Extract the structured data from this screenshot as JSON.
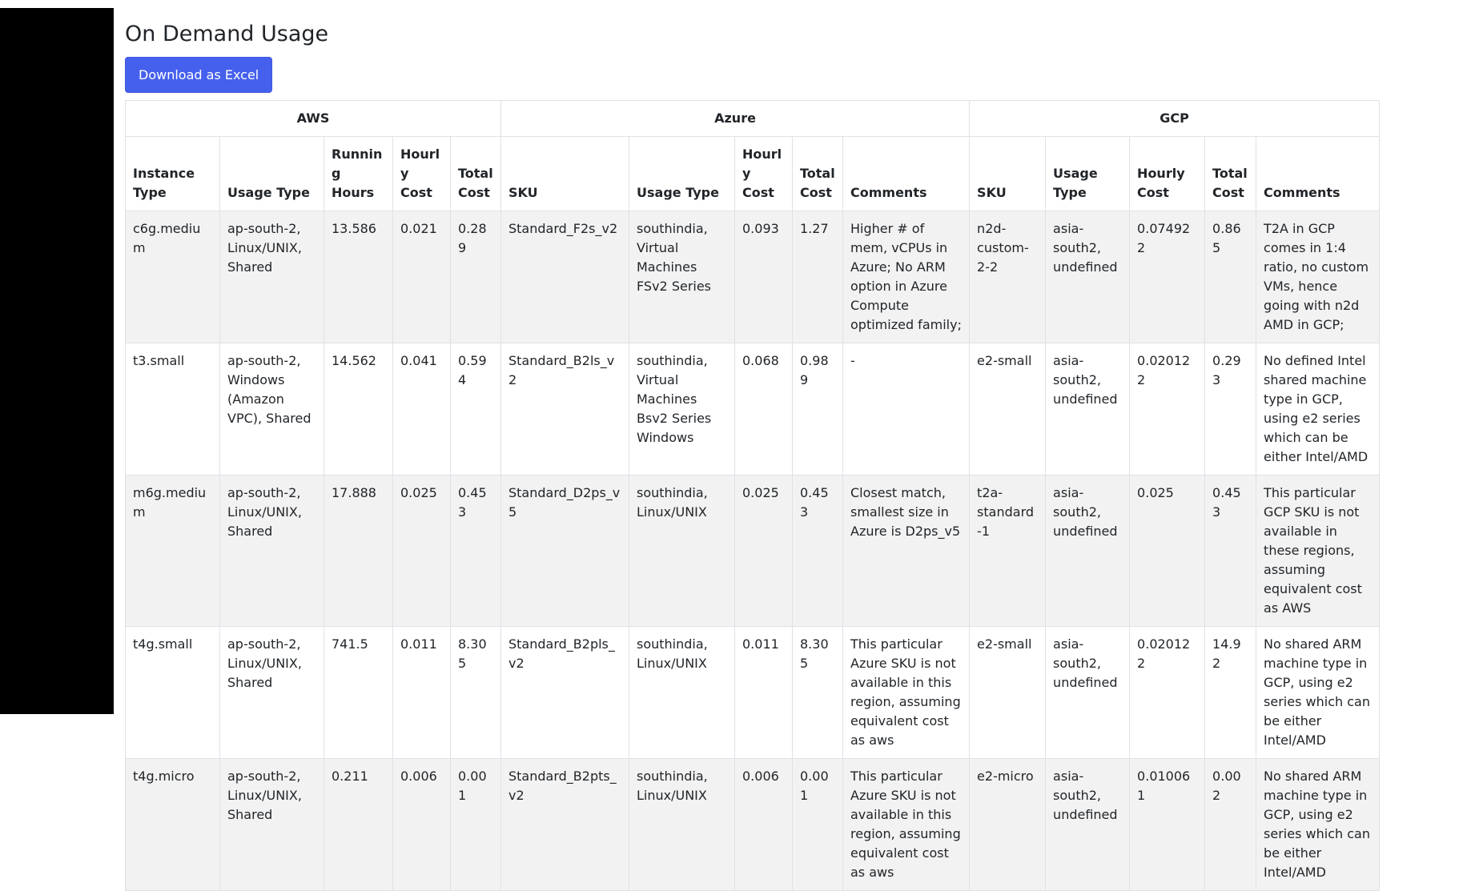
{
  "page": {
    "title": "On Demand Usage",
    "download_label": "Download as Excel"
  },
  "table": {
    "groups": [
      "AWS",
      "Azure",
      "GCP"
    ],
    "columns": [
      "Instance Type",
      "Usage Type",
      "Running Hours",
      "Hourly Cost",
      "Total Cost",
      "SKU",
      "Usage Type",
      "Hourly Cost",
      "Total Cost",
      "Comments",
      "SKU",
      "Usage Type",
      "Hourly Cost",
      "Total Cost",
      "Comments"
    ],
    "rows": [
      [
        "c6g.medium",
        "ap-south-2, Linux/UNIX, Shared",
        "13.586",
        "0.021",
        "0.289",
        "Standard_F2s_v2",
        "southindia, Virtual Machines FSv2 Series",
        "0.093",
        "1.27",
        "Higher # of mem, vCPUs in Azure; No ARM option in Azure Compute optimized family;",
        "n2d-custom-2-2",
        "asia-south2, undefined",
        "0.074922",
        "0.865",
        "T2A in GCP comes in 1:4 ratio, no custom VMs, hence going with n2d AMD in GCP;"
      ],
      [
        "t3.small",
        "ap-south-2, Windows (Amazon VPC), Shared",
        "14.562",
        "0.041",
        "0.594",
        "Standard_B2ls_v2",
        "southindia, Virtual Machines Bsv2 Series Windows",
        "0.068",
        "0.989",
        "-",
        "e2-small",
        "asia-south2, undefined",
        "0.020122",
        "0.293",
        "No defined Intel shared machine type in GCP, using e2 series which can be either Intel/AMD"
      ],
      [
        "m6g.medium",
        "ap-south-2, Linux/UNIX, Shared",
        "17.888",
        "0.025",
        "0.453",
        "Standard_D2ps_v5",
        "southindia, Linux/UNIX",
        "0.025",
        "0.453",
        "Closest match, smallest size in Azure is D2ps_v5",
        "t2a-standard-1",
        "asia-south2, undefined",
        "0.025",
        "0.453",
        "This particular GCP SKU is not available in these regions, assuming equivalent cost as AWS"
      ],
      [
        "t4g.small",
        "ap-south-2, Linux/UNIX, Shared",
        "741.5",
        "0.011",
        "8.305",
        "Standard_B2pls_v2",
        "southindia, Linux/UNIX",
        "0.011",
        "8.305",
        "This particular Azure SKU is not available in this region, assuming equivalent cost as aws",
        "e2-small",
        "asia-south2, undefined",
        "0.020122",
        "14.92",
        "No shared ARM machine type in GCP, using e2 series which can be either Intel/AMD"
      ],
      [
        "t4g.micro",
        "ap-south-2, Linux/UNIX, Shared",
        "0.211",
        "0.006",
        "0.001",
        "Standard_B2pts_v2",
        "southindia, Linux/UNIX",
        "0.006",
        "0.001",
        "This particular Azure SKU is not available in this region, assuming equivalent cost as aws",
        "e2-micro",
        "asia-south2, undefined",
        "0.010061",
        "0.002",
        "No shared ARM machine type in GCP, using e2 series which can be either Intel/AMD"
      ]
    ]
  },
  "colors": {
    "accent": "#4660ee",
    "sidebar": "#000000",
    "row_stripe": "#f2f2f2",
    "border": "#dee2e6"
  }
}
